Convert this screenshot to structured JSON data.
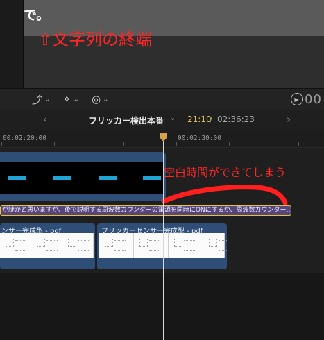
{
  "viewer": {
    "caption_text": "で。",
    "annotation_end": "⇧文字列の終端"
  },
  "viewer_bar": {
    "tools": [
      {
        "icon": "crop-transform-icon",
        "glyph": "⤴"
      },
      {
        "icon": "magic-wand-icon",
        "glyph": "✧"
      },
      {
        "icon": "speed-retime-icon",
        "glyph": "◎"
      }
    ],
    "timecode": "00"
  },
  "timeline_header": {
    "project_title": "フリッカー検出本番",
    "current_time": "21:10",
    "separator": "/",
    "total_time": "02:36:23"
  },
  "ruler": {
    "labels": [
      "00:02:20:00",
      "00:02:30:00"
    ]
  },
  "caption_track": {
    "text": "が謎かと思いますが、後で説明する周波数カウンターの電源を同時にONにするか、周波数カウンター…"
  },
  "pdf_clips": [
    {
      "title": "ンサー完成型 - pdf"
    },
    {
      "title": "フリッカーセンサー完成型 - pdf"
    }
  ],
  "annotations": {
    "gap_text": "空白時間ができてしまう"
  },
  "colors": {
    "annotation": "#ff2626",
    "clip_blue": "#2f4e77",
    "caption_purple": "#56467a",
    "caption_border": "#e6c43a",
    "timecode_yellow": "#e0c44a"
  }
}
